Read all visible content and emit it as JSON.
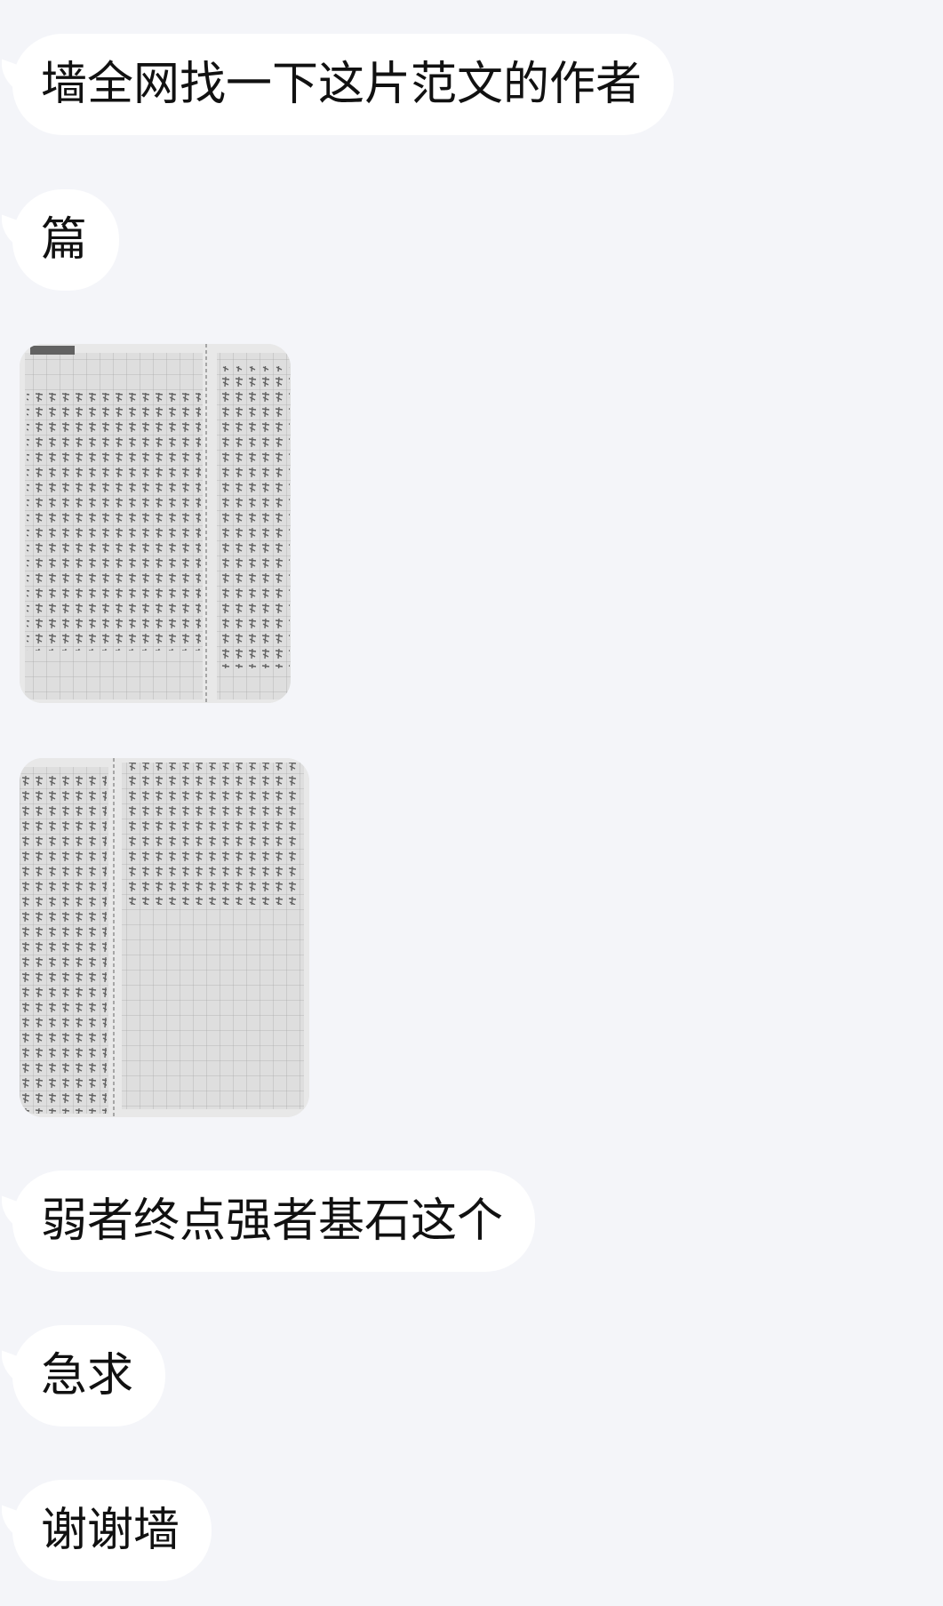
{
  "messages": [
    {
      "type": "text",
      "text": "墙全网找一下这片范文的作者"
    },
    {
      "type": "text",
      "text": "篇"
    },
    {
      "type": "image",
      "description_icon": "photo-icon"
    },
    {
      "type": "image",
      "description_icon": "photo-icon"
    },
    {
      "type": "text",
      "text": "弱者终点强者基石这个"
    },
    {
      "type": "text",
      "text": "急求"
    },
    {
      "type": "text",
      "text": "谢谢墙"
    }
  ],
  "colors": {
    "background": "#f4f5f9",
    "bubble": "#ffffff",
    "text": "#111111",
    "paper": "#e2e2e2",
    "grid": "#9a9a9a",
    "ink": "#3a3a3a"
  }
}
